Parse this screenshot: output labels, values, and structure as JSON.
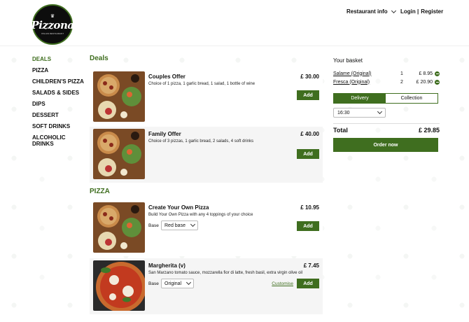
{
  "brand": {
    "logo_text": "Pizzona",
    "logo_sub": "ITALIAN RESTAURANT",
    "accent": "#3f6e1f"
  },
  "header": {
    "restaurant_info": "Restaurant info",
    "login": "Login |",
    "register": "Register"
  },
  "sidebar": {
    "items": [
      {
        "label": "DEALS",
        "active": true
      },
      {
        "label": "PIZZA"
      },
      {
        "label": "CHILDREN'S PIZZA"
      },
      {
        "label": "SALADS & SIDES"
      },
      {
        "label": "DIPS"
      },
      {
        "label": "DESSERT"
      },
      {
        "label": "SOFT DRINKS"
      },
      {
        "label": "ALCOHOLIC DRINKS"
      }
    ]
  },
  "sections": {
    "deals": "Deals",
    "pizza": "PIZZA"
  },
  "items": [
    {
      "name": "Couples Offer",
      "price": "£ 30.00",
      "desc": "Choice of 1 pizza, 1 garlic bread, 1 salad, 1 bottle of wine",
      "add": "Add"
    },
    {
      "name": "Family Offer",
      "price": "£ 40.00",
      "desc": "Choice of 3 pizzas, 1 garlic bread, 2 salads, 4 soft drinks",
      "add": "Add"
    },
    {
      "name": "Create Your Own Pizza",
      "price": "£ 10.95",
      "desc": "Build Your Own Pizza with any 4 toppings of your choice",
      "base_label": "Base",
      "base_value": "Red base",
      "add": "Add"
    },
    {
      "name": "Margherita (v)",
      "price": "£ 7.45",
      "desc": "San Marzano tomato sauce, mozzarella fior di latte, fresh basil, extra virgin olive oil",
      "base_label": "Base",
      "base_value": "Original",
      "customise": "Customise",
      "add": "Add"
    }
  ],
  "basket": {
    "title": "Your basket",
    "lines": [
      {
        "item": "Salame (Original)",
        "qty": "1",
        "price": "£ 8.95"
      },
      {
        "item": "Fresca (Original)",
        "qty": "2",
        "price": "£ 20.90"
      }
    ],
    "delivery": "Delivery",
    "collection": "Collection",
    "time": "16:30",
    "total_label": "Total",
    "total_value": "£ 29.85",
    "order_now": "Order now"
  }
}
